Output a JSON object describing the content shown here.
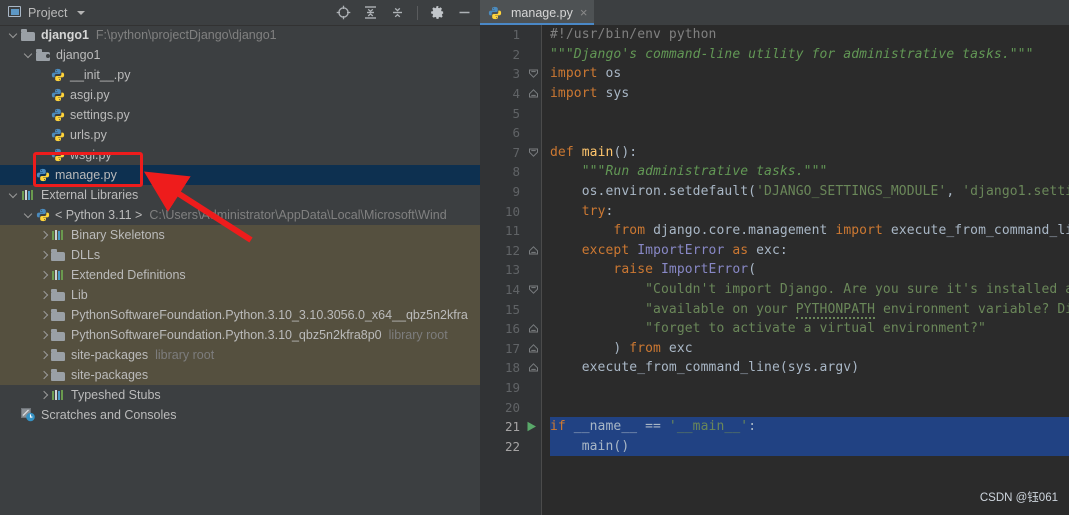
{
  "project_panel": {
    "title": "Project",
    "icons": {
      "panel": "project-panel-icon",
      "dropdown": "chevron-down-icon",
      "locate": "locate-target-icon",
      "expand_all": "expand-all-icon",
      "collapse_all": "collapse-all-icon",
      "settings": "gear-icon",
      "hide": "minimize-icon"
    },
    "tree": [
      {
        "id": "django1-root",
        "depth": 0,
        "twisty": "down",
        "icon": "folder",
        "label": "django1",
        "bold": true,
        "path": "F:\\python\\projectDjango\\django1"
      },
      {
        "id": "django1-module",
        "depth": 1,
        "twisty": "down",
        "icon": "folder-module",
        "label": "django1"
      },
      {
        "id": "init-py",
        "depth": 2,
        "twisty": "none",
        "icon": "python-file",
        "label": "__init__.py"
      },
      {
        "id": "asgi-py",
        "depth": 2,
        "twisty": "none",
        "icon": "python-file",
        "label": "asgi.py"
      },
      {
        "id": "settings-py",
        "depth": 2,
        "twisty": "none",
        "icon": "python-file",
        "label": "settings.py"
      },
      {
        "id": "urls-py",
        "depth": 2,
        "twisty": "none",
        "icon": "python-file",
        "label": "urls.py"
      },
      {
        "id": "wsgi-py",
        "depth": 2,
        "twisty": "none",
        "icon": "python-file",
        "label": "wsgi.py"
      },
      {
        "id": "manage-py",
        "depth": 1,
        "twisty": "none",
        "icon": "python-file",
        "label": "manage.py",
        "selected": true
      },
      {
        "id": "external-libraries",
        "depth": 0,
        "twisty": "down",
        "icon": "library",
        "label": "External Libraries"
      },
      {
        "id": "python-311",
        "depth": 1,
        "twisty": "down",
        "icon": "python-sdk",
        "label": "< Python 3.11 >",
        "path": "C:\\Users\\Administrator\\AppData\\Local\\Microsoft\\Wind"
      },
      {
        "id": "binary-skeletons",
        "depth": 2,
        "twisty": "right",
        "icon": "library",
        "label": "Binary Skeletons",
        "olive": true
      },
      {
        "id": "dlls",
        "depth": 2,
        "twisty": "right",
        "icon": "folder",
        "label": "DLLs",
        "olive": true
      },
      {
        "id": "extended-definitions",
        "depth": 2,
        "twisty": "right",
        "icon": "library",
        "label": "Extended Definitions",
        "olive": true
      },
      {
        "id": "lib",
        "depth": 2,
        "twisty": "right",
        "icon": "folder",
        "label": "Lib",
        "olive": true
      },
      {
        "id": "psf-python-3103056",
        "depth": 2,
        "twisty": "right",
        "icon": "folder",
        "label": "PythonSoftwareFoundation.Python.3.10_3.10.3056.0_x64__qbz5n2kfra",
        "olive": true
      },
      {
        "id": "psf-python-310-qbz",
        "depth": 2,
        "twisty": "right",
        "icon": "folder",
        "label": "PythonSoftwareFoundation.Python.3.10_qbz5n2kfra8p0",
        "note": "library root",
        "olive": true
      },
      {
        "id": "site-packages-root",
        "depth": 2,
        "twisty": "right",
        "icon": "folder",
        "label": "site-packages",
        "note": "library root",
        "olive": true
      },
      {
        "id": "site-packages-2",
        "depth": 2,
        "twisty": "right",
        "icon": "folder",
        "label": "site-packages",
        "olive": true
      },
      {
        "id": "typeshed-stubs",
        "depth": 2,
        "twisty": "right",
        "icon": "library",
        "label": "Typeshed Stubs"
      },
      {
        "id": "scratches-and-consoles",
        "depth": 0,
        "twisty": "none",
        "icon": "scratch",
        "label": "Scratches and Consoles"
      }
    ]
  },
  "annotation": {
    "box_color": "#ee1c1c",
    "arrow_color": "#ee1c1c",
    "target": "manage.py"
  },
  "editor": {
    "tab": {
      "label": "manage.py",
      "close": "×",
      "icon": "python-file-icon",
      "active": true
    },
    "watermark": "CSDN @钰061",
    "lines": [
      {
        "n": 1,
        "fold": "none",
        "tokens": [
          {
            "t": "#!/usr/bin/env python",
            "c": "cmt"
          }
        ]
      },
      {
        "n": 2,
        "fold": "none",
        "tokens": [
          {
            "t": "\"\"\"Django's command-line utility for administrative tasks.\"\"\"",
            "c": "doc"
          }
        ]
      },
      {
        "n": 3,
        "fold": "start",
        "tokens": [
          {
            "t": "import ",
            "c": "kw"
          },
          {
            "t": "os",
            "c": "pln"
          }
        ]
      },
      {
        "n": 4,
        "fold": "end",
        "tokens": [
          {
            "t": "import ",
            "c": "kw"
          },
          {
            "t": "sys",
            "c": "pln"
          }
        ]
      },
      {
        "n": 5,
        "fold": "none",
        "tokens": []
      },
      {
        "n": 6,
        "fold": "none",
        "tokens": []
      },
      {
        "n": 7,
        "fold": "start",
        "tokens": [
          {
            "t": "def ",
            "c": "kw"
          },
          {
            "t": "main",
            "c": "fn"
          },
          {
            "t": "():",
            "c": "pln"
          }
        ]
      },
      {
        "n": 8,
        "fold": "none",
        "tokens": [
          {
            "t": "    \"\"\"Run administrative tasks.\"\"\"",
            "c": "doc"
          }
        ]
      },
      {
        "n": 9,
        "fold": "none",
        "tokens": [
          {
            "t": "    os.environ.setdefault(",
            "c": "pln"
          },
          {
            "t": "'DJANGO_SETTINGS_MODULE'",
            "c": "str"
          },
          {
            "t": ", ",
            "c": "pln"
          },
          {
            "t": "'django1.setti",
            "c": "str"
          }
        ]
      },
      {
        "n": 10,
        "fold": "none",
        "tokens": [
          {
            "t": "    ",
            "c": "pln"
          },
          {
            "t": "try",
            "c": "kw"
          },
          {
            "t": ":",
            "c": "pln"
          }
        ]
      },
      {
        "n": 11,
        "fold": "none",
        "tokens": [
          {
            "t": "        ",
            "c": "pln"
          },
          {
            "t": "from ",
            "c": "kw"
          },
          {
            "t": "django.core.management ",
            "c": "pln"
          },
          {
            "t": "import ",
            "c": "kw"
          },
          {
            "t": "execute_from_command_li",
            "c": "pln"
          }
        ]
      },
      {
        "n": 12,
        "fold": "end",
        "tokens": [
          {
            "t": "    ",
            "c": "pln"
          },
          {
            "t": "except ",
            "c": "kw"
          },
          {
            "t": "ImportError ",
            "c": "cls"
          },
          {
            "t": "as ",
            "c": "kw"
          },
          {
            "t": "exc:",
            "c": "pln"
          }
        ]
      },
      {
        "n": 13,
        "fold": "none",
        "tokens": [
          {
            "t": "        ",
            "c": "pln"
          },
          {
            "t": "raise ",
            "c": "kw"
          },
          {
            "t": "ImportError",
            "c": "cls"
          },
          {
            "t": "(",
            "c": "pln"
          }
        ]
      },
      {
        "n": 14,
        "fold": "start",
        "tokens": [
          {
            "t": "            \"Couldn't import Django. Are you sure it's installed a",
            "c": "str"
          }
        ]
      },
      {
        "n": 15,
        "fold": "none",
        "tokens": [
          {
            "t": "            \"available on your ",
            "c": "str"
          },
          {
            "t": "PYTHONPATH",
            "c": "str typo"
          },
          {
            "t": " environment variable? Di",
            "c": "str"
          }
        ]
      },
      {
        "n": 16,
        "fold": "end",
        "tokens": [
          {
            "t": "            \"forget to activate a virtual environment?\"",
            "c": "str"
          }
        ]
      },
      {
        "n": 17,
        "fold": "end",
        "tokens": [
          {
            "t": "        ) ",
            "c": "pln"
          },
          {
            "t": "from ",
            "c": "kw"
          },
          {
            "t": "exc",
            "c": "pln"
          }
        ]
      },
      {
        "n": 18,
        "fold": "end",
        "tokens": [
          {
            "t": "    execute_from_command_line(sys.argv)",
            "c": "pln"
          }
        ]
      },
      {
        "n": 19,
        "fold": "none",
        "tokens": []
      },
      {
        "n": 20,
        "fold": "none",
        "tokens": []
      },
      {
        "n": 21,
        "fold": "none",
        "run": true,
        "selected": true,
        "tokens": [
          {
            "t": "if ",
            "c": "kw"
          },
          {
            "t": "__name__ == ",
            "c": "pln"
          },
          {
            "t": "'__main__'",
            "c": "str"
          },
          {
            "t": ":",
            "c": "pln"
          }
        ]
      },
      {
        "n": 22,
        "fold": "none",
        "selected": true,
        "tokens": [
          {
            "t": "    main()",
            "c": "pln"
          }
        ]
      }
    ]
  },
  "colors": {
    "panel_bg": "#3c3f41",
    "editor_bg": "#2b2b2b",
    "gutter_bg": "#313335",
    "selection": "#214283",
    "tree_selected": "#0d3050",
    "tree_olive": "#55503f",
    "accent": "#4a88c7",
    "annotation_red": "#ee1c1c"
  }
}
